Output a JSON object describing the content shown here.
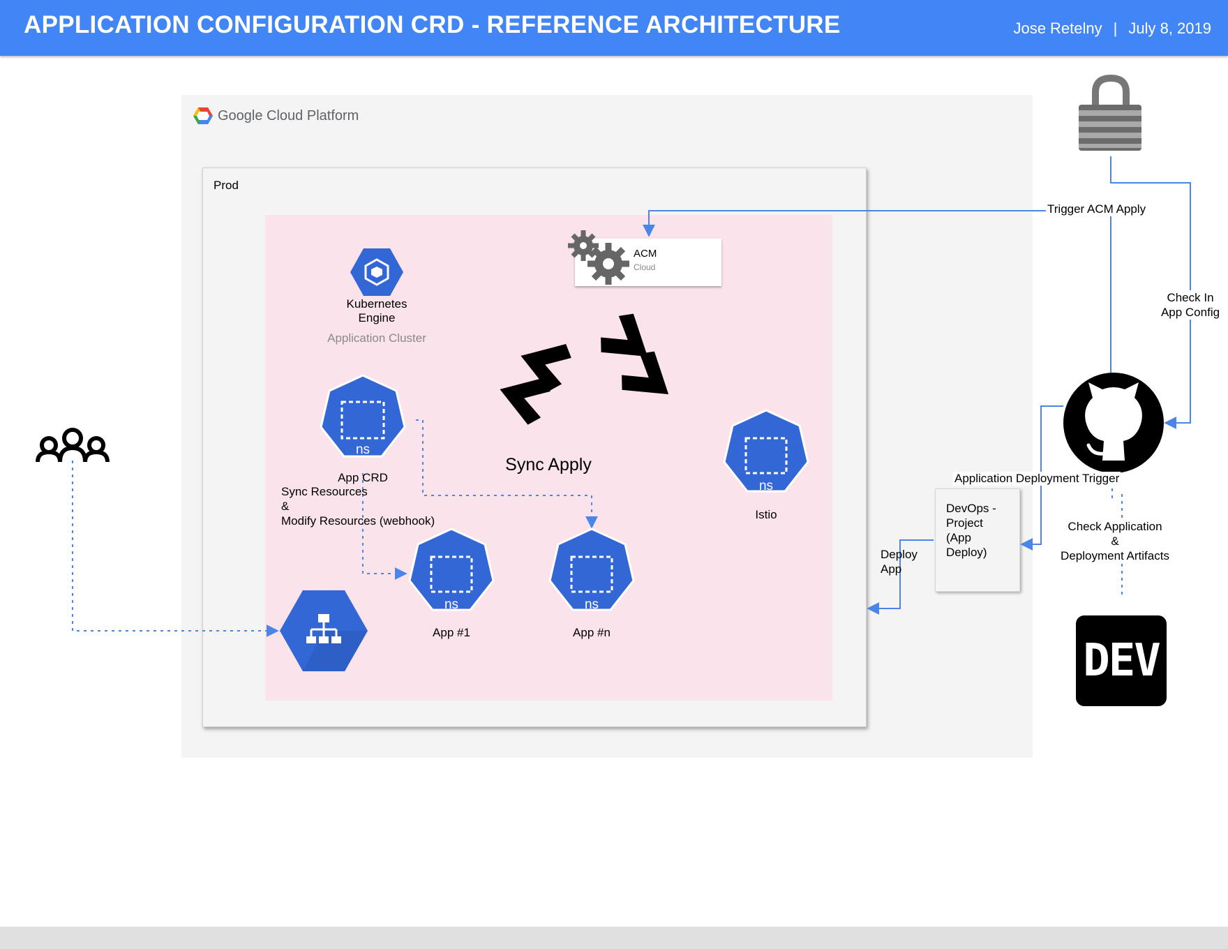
{
  "header": {
    "title": "APPLICATION CONFIGURATION CRD - REFERENCE ARCHITECTURE",
    "author": "Jose Retelny",
    "separator": "|",
    "date": "July 8, 2019"
  },
  "gcp": {
    "logo_text": "Google Cloud Platform"
  },
  "prod": {
    "label": "Prod"
  },
  "kubernetes": {
    "name_line1": "Kubernetes",
    "name_line2": "Engine",
    "subtitle": "Application Cluster"
  },
  "acm": {
    "title": "ACM",
    "subtitle": "Cloud"
  },
  "sync_apply": "Sync Apply",
  "namespaces": {
    "ns_text": "ns",
    "app_crd": "App CRD",
    "app1": "App #1",
    "appn": "App #n",
    "istio": "Istio"
  },
  "annotations": {
    "sync_line1": "Sync Resources",
    "sync_line2": "&",
    "sync_line3": "Modify Resources (webhook)",
    "trigger_acm": "Trigger ACM Apply",
    "check_in_line1": "Check In",
    "check_in_line2": "App Config",
    "app_deploy_trigger": "Application Deployment Trigger",
    "deploy_line1": "Deploy",
    "deploy_line2": "App",
    "check_artifacts_line1": "Check Application",
    "check_artifacts_line2": "&",
    "check_artifacts_line3": "Deployment Artifacts"
  },
  "devops": {
    "line1": "DevOps -",
    "line2": "Project",
    "line3": "(App",
    "line4": "Deploy)"
  },
  "dev_badge": "DEV",
  "colors": {
    "header": "#4285f4",
    "hex_blue": "#3367d6",
    "connector_blue": "#4a86e8",
    "pink_area": "#fae3ea"
  },
  "icons": [
    "users-icon",
    "lock-icon",
    "github-icon",
    "gear-icon",
    "kubernetes-engine-icon",
    "load-balancer-icon",
    "gcp-logo-icon",
    "dev-icon"
  ]
}
